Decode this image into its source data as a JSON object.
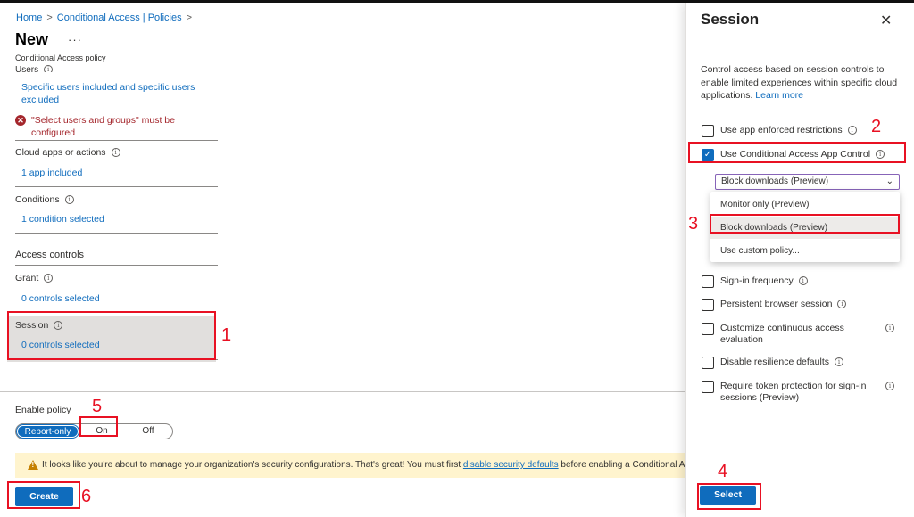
{
  "breadcrumb": {
    "home": "Home",
    "policies": "Conditional Access | Policies",
    "sep": ">"
  },
  "page": {
    "title": "New",
    "more": "···",
    "subtitle": "Conditional Access policy"
  },
  "users": {
    "label": "Users",
    "summary_line1": "Specific users included and specific users",
    "summary_line2": "excluded",
    "error_line1": "\"Select users and groups\" must be",
    "error_line2": "configured"
  },
  "cloud_apps": {
    "label": "Cloud apps or actions",
    "value": "1 app included"
  },
  "conditions": {
    "label": "Conditions",
    "value": "1 condition selected"
  },
  "access_controls": {
    "heading": "Access controls"
  },
  "grant": {
    "label": "Grant",
    "value": "0 controls selected"
  },
  "session": {
    "label": "Session",
    "value": "0 controls selected"
  },
  "enable_policy": {
    "label": "Enable policy",
    "options": [
      "Report-only",
      "On",
      "Off"
    ],
    "selected": "Report-only"
  },
  "warning": {
    "prefix": "It looks like you're about to manage your organization's security configurations. That's great! You must first ",
    "link": "disable security defaults",
    "suffix": " before enabling a Conditional Access policy."
  },
  "create_button": "Create",
  "panel": {
    "title": "Session",
    "close": "✕",
    "desc": "Control access based on session controls to enable limited experiences within specific cloud applications. ",
    "learn_more": "Learn more",
    "options": [
      {
        "label": "Use app enforced restrictions",
        "checked": false
      },
      {
        "label": "Use Conditional Access App Control",
        "checked": true
      },
      {
        "label": "Sign-in frequency",
        "checked": false
      },
      {
        "label": "Persistent browser session",
        "checked": false
      },
      {
        "label": "Customize continuous access",
        "label2": "evaluation",
        "checked": false
      },
      {
        "label": "Disable resilience defaults",
        "checked": false
      },
      {
        "label": "Require token protection for sign-in",
        "label2": "sessions (Preview)",
        "checked": false
      }
    ],
    "dropdown": {
      "value": "Block downloads (Preview)",
      "items": [
        "Monitor only (Preview)",
        "Block downloads (Preview)",
        "Use custom policy..."
      ],
      "highlighted": "Block downloads (Preview)"
    },
    "select_button": "Select"
  },
  "annotations": [
    "1",
    "2",
    "3",
    "4",
    "5",
    "6"
  ],
  "colors": {
    "accent": "#0f6cbd",
    "error": "#a4262c",
    "annotation": "#e81123",
    "warning_bg": "#fff4ce"
  }
}
